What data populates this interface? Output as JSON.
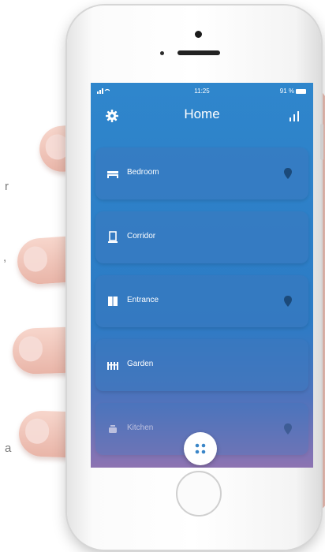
{
  "status_bar": {
    "time": "11:25",
    "battery": "91 %"
  },
  "header": {
    "title": "Home",
    "settings_icon": "gear-icon",
    "stats_icon": "bar-chart-icon"
  },
  "rooms": [
    {
      "label": "Bedroom",
      "icon": "bed-icon",
      "pin": true
    },
    {
      "label": "Corridor",
      "icon": "lamp-icon",
      "pin": false
    },
    {
      "label": "Entrance",
      "icon": "door-icon",
      "pin": true
    },
    {
      "label": "Garden",
      "icon": "fence-icon",
      "pin": false
    },
    {
      "label": "Kitchen",
      "icon": "pot-icon",
      "pin": true
    }
  ],
  "fab_icon": "grid-dots-icon",
  "background_marks": [
    "r",
    ",",
    "a"
  ],
  "colors": {
    "screen_top": "#2f86cc",
    "screen_bottom": "#8d73b2",
    "pin": "#1b4a7a"
  }
}
